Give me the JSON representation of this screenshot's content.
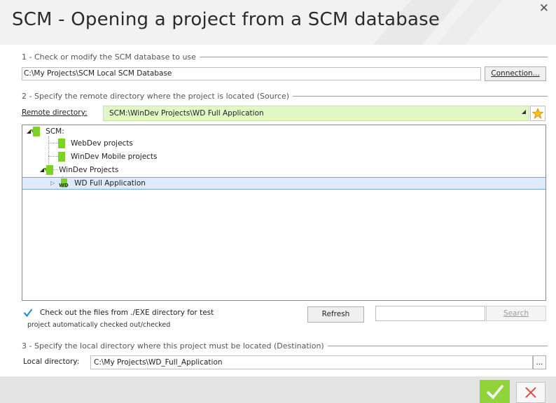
{
  "window": {
    "title": "SCM - Opening a project from a SCM database"
  },
  "section1": {
    "header": "1 -  Check or modify the SCM database to use",
    "database_value": "C:\\My Projects\\SCM Local SCM Database",
    "connection_button": "Connection..."
  },
  "section2": {
    "header": "2 -  Specify the remote directory where the project is located (Source)",
    "remote_label": "Remote directory:",
    "remote_value": "SCM:\\WinDev Projects\\WD Full Application",
    "tree": {
      "root": "SCM:",
      "items": [
        "WebDev projects",
        "WinDev Mobile projects",
        "WinDev Projects"
      ],
      "selected": "WD Full Application",
      "selected_icon_text": "WD"
    },
    "checkbox_label": "Check out the files from ./EXE directory for test",
    "info_text": "project automatically checked out/checked",
    "refresh_button": "Refresh",
    "search_placeholder": "",
    "search_button": "Search"
  },
  "section3": {
    "header": "3 - Specify the local directory where this project must be located (Destination)",
    "local_label": "Local directory:",
    "local_value": "C:\\My Projects\\WD_Full_Application",
    "browse_button": "..."
  },
  "colors": {
    "accent_green": "#90d33a",
    "folder_green": "#7dd324",
    "remote_field_bg": "#e2f7c6",
    "selection_bg": "#dcebfc",
    "cancel_red": "#e04848",
    "star_yellow": "#f7c21d"
  },
  "icons": [
    "close-icon",
    "star-icon",
    "folder-icon",
    "wd-project-icon",
    "checkmark-icon",
    "dropdown-icon",
    "expand-icon",
    "collapse-icon"
  ]
}
